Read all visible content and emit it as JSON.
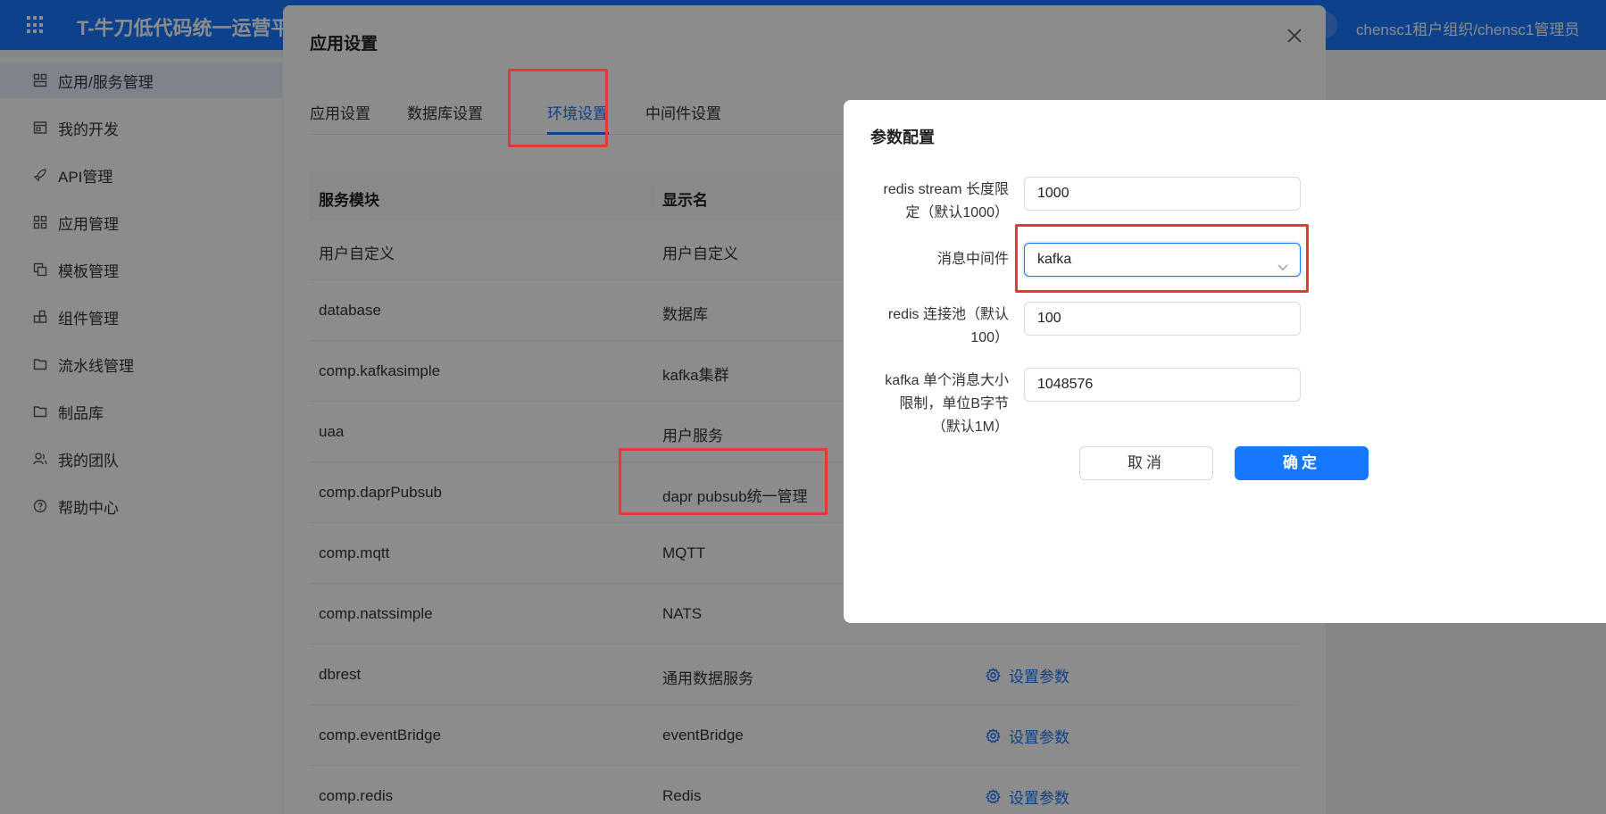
{
  "topbar": {
    "title": "T-牛刀低代码统一运营平",
    "user": "chensc1租户组织/chensc1管理员"
  },
  "sidebar": {
    "items": [
      {
        "label": "应用/服务管理",
        "icon": "layout-icon"
      },
      {
        "label": "我的开发",
        "icon": "window-icon"
      },
      {
        "label": "API管理",
        "icon": "rocket-icon"
      },
      {
        "label": "应用管理",
        "icon": "grid-icon"
      },
      {
        "label": "模板管理",
        "icon": "copy-icon"
      },
      {
        "label": "组件管理",
        "icon": "blocks-icon"
      },
      {
        "label": "流水线管理",
        "icon": "folder-icon"
      },
      {
        "label": "制品库",
        "icon": "folder-icon"
      },
      {
        "label": "我的团队",
        "icon": "team-icon"
      },
      {
        "label": "帮助中心",
        "icon": "help-icon"
      }
    ]
  },
  "settings": {
    "title": "应用设置",
    "tabs": [
      "应用设置",
      "数据库设置",
      "环境设置",
      "中间件设置"
    ],
    "active_tab": "环境设置",
    "columns": [
      "服务模块",
      "显示名"
    ],
    "rows": [
      {
        "module": "用户自定义",
        "display": "用户自定义",
        "action": ""
      },
      {
        "module": "database",
        "display": "数据库",
        "action": ""
      },
      {
        "module": "comp.kafkasimple",
        "display": "kafka集群",
        "action": ""
      },
      {
        "module": "uaa",
        "display": "用户服务",
        "action": ""
      },
      {
        "module": "comp.daprPubsub",
        "display": "dapr pubsub统一管理",
        "action": ""
      },
      {
        "module": "comp.mqtt",
        "display": "MQTT",
        "action": ""
      },
      {
        "module": "comp.natssimple",
        "display": "NATS",
        "action": ""
      },
      {
        "module": "dbrest",
        "display": "通用数据服务",
        "action": "设置参数"
      },
      {
        "module": "comp.eventBridge",
        "display": "eventBridge",
        "action": "设置参数"
      },
      {
        "module": "comp.redis",
        "display": "Redis",
        "action": "设置参数"
      }
    ]
  },
  "param_dialog": {
    "title": "参数配置",
    "fields": {
      "stream_label_1": "redis stream 长度限",
      "stream_label_2": "定（默认1000）",
      "stream_value": "1000",
      "mq_label": "消息中间件",
      "mq_value": "kafka",
      "pool_label_1": "redis 连接池（默认",
      "pool_label_2": "100）",
      "pool_value": "100",
      "kafka_label_1": "kafka 单个消息大小",
      "kafka_label_2": "限制，单位B字节",
      "kafka_label_3": "（默认1M）",
      "kafka_value": "1048576"
    },
    "cancel_label": "取消",
    "ok_label": "确定"
  },
  "colors": {
    "primary": "#1677ff",
    "annotation_red": "#e53935"
  }
}
